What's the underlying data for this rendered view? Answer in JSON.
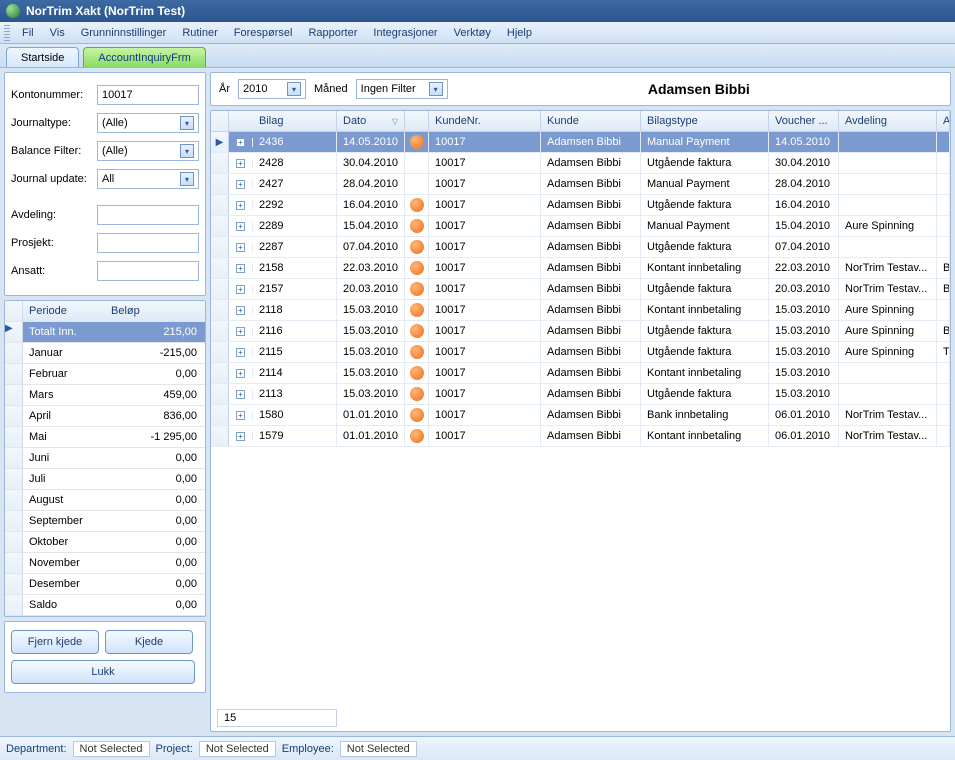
{
  "window": {
    "title": "NorTrim Xakt (NorTrim Test)"
  },
  "menu": [
    "Fil",
    "Vis",
    "Grunninnstillinger",
    "Rutiner",
    "Forespørsel",
    "Rapporter",
    "Integrasjoner",
    "Verktøy",
    "Hjelp"
  ],
  "tabs": {
    "start": "Startside",
    "inquiry": "AccountInquiryFrm"
  },
  "filters": {
    "kontonummer_label": "Kontonummer:",
    "kontonummer": "10017",
    "journaltype_label": "Journaltype:",
    "journaltype": "(Alle)",
    "balance_label": "Balance Filter:",
    "balance": "(Alle)",
    "update_label": "Journal update:",
    "update": "All",
    "avdeling_label": "Avdeling:",
    "avdeling": "",
    "prosjekt_label": "Prosjekt:",
    "prosjekt": "",
    "ansatt_label": "Ansatt:",
    "ansatt": ""
  },
  "periods": {
    "headers": {
      "c1": "Periode",
      "c2": "Beløp"
    },
    "rows": [
      {
        "label": "Totalt Inn.",
        "value": "215,00",
        "selected": true
      },
      {
        "label": "Januar",
        "value": "-215,00"
      },
      {
        "label": "Februar",
        "value": "0,00"
      },
      {
        "label": "Mars",
        "value": "459,00"
      },
      {
        "label": "April",
        "value": "836,00"
      },
      {
        "label": "Mai",
        "value": "-1 295,00"
      },
      {
        "label": "Juni",
        "value": "0,00"
      },
      {
        "label": "Juli",
        "value": "0,00"
      },
      {
        "label": "August",
        "value": "0,00"
      },
      {
        "label": "September",
        "value": "0,00"
      },
      {
        "label": "Oktober",
        "value": "0,00"
      },
      {
        "label": "November",
        "value": "0,00"
      },
      {
        "label": "Desember",
        "value": "0,00"
      },
      {
        "label": "Saldo",
        "value": "0,00"
      }
    ]
  },
  "buttons": {
    "fjern": "Fjern kjede",
    "kjede": "Kjede",
    "lukk": "Lukk"
  },
  "toolbar": {
    "ar_label": "År",
    "ar": "2010",
    "maned_label": "Måned",
    "maned": "Ingen Filter",
    "customer": "Adamsen Bibbi"
  },
  "grid": {
    "headers": {
      "bilag": "Bilag",
      "dato": "Dato",
      "kundenr": "KundeNr.",
      "kunde": "Kunde",
      "btype": "Bilagstype",
      "voucher": "Voucher ...",
      "avdeling": "Avdeling",
      "ans": "Ans"
    },
    "rows": [
      {
        "bilag": "2436",
        "dato": "14.05.2010",
        "ico": true,
        "kundenr": "10017",
        "kunde": "Adamsen Bibbi",
        "btype": "Manual Payment",
        "voucher": "14.05.2010",
        "avd": "",
        "ans": "",
        "selected": true
      },
      {
        "bilag": "2428",
        "dato": "30.04.2010",
        "ico": false,
        "kundenr": "10017",
        "kunde": "Adamsen Bibbi",
        "btype": "Utgående faktura",
        "voucher": "30.04.2010",
        "avd": "",
        "ans": ""
      },
      {
        "bilag": "2427",
        "dato": "28.04.2010",
        "ico": false,
        "kundenr": "10017",
        "kunde": "Adamsen Bibbi",
        "btype": "Manual Payment",
        "voucher": "28.04.2010",
        "avd": "",
        "ans": ""
      },
      {
        "bilag": "2292",
        "dato": "16.04.2010",
        "ico": true,
        "kundenr": "10017",
        "kunde": "Adamsen Bibbi",
        "btype": "Utgående faktura",
        "voucher": "16.04.2010",
        "avd": "",
        "ans": ""
      },
      {
        "bilag": "2289",
        "dato": "15.04.2010",
        "ico": true,
        "kundenr": "10017",
        "kunde": "Adamsen Bibbi",
        "btype": "Manual Payment",
        "voucher": "15.04.2010",
        "avd": "Aure Spinning",
        "ans": ""
      },
      {
        "bilag": "2287",
        "dato": "07.04.2010",
        "ico": true,
        "kundenr": "10017",
        "kunde": "Adamsen Bibbi",
        "btype": "Utgående faktura",
        "voucher": "07.04.2010",
        "avd": "",
        "ans": ""
      },
      {
        "bilag": "2158",
        "dato": "22.03.2010",
        "ico": true,
        "kundenr": "10017",
        "kunde": "Adamsen Bibbi",
        "btype": "Kontant innbetaling",
        "voucher": "22.03.2010",
        "avd": "NorTrim Testav...",
        "ans": "Bjør"
      },
      {
        "bilag": "2157",
        "dato": "20.03.2010",
        "ico": true,
        "kundenr": "10017",
        "kunde": "Adamsen Bibbi",
        "btype": "Utgående faktura",
        "voucher": "20.03.2010",
        "avd": "NorTrim Testav...",
        "ans": "Bjør"
      },
      {
        "bilag": "2118",
        "dato": "15.03.2010",
        "ico": true,
        "kundenr": "10017",
        "kunde": "Adamsen Bibbi",
        "btype": "Kontant innbetaling",
        "voucher": "15.03.2010",
        "avd": "Aure Spinning",
        "ans": ""
      },
      {
        "bilag": "2116",
        "dato": "15.03.2010",
        "ico": true,
        "kundenr": "10017",
        "kunde": "Adamsen Bibbi",
        "btype": "Utgående faktura",
        "voucher": "15.03.2010",
        "avd": "Aure Spinning",
        "ans": "Bjør"
      },
      {
        "bilag": "2115",
        "dato": "15.03.2010",
        "ico": true,
        "kundenr": "10017",
        "kunde": "Adamsen Bibbi",
        "btype": "Utgående faktura",
        "voucher": "15.03.2010",
        "avd": "Aure Spinning",
        "ans": "Trun"
      },
      {
        "bilag": "2114",
        "dato": "15.03.2010",
        "ico": true,
        "kundenr": "10017",
        "kunde": "Adamsen Bibbi",
        "btype": "Kontant innbetaling",
        "voucher": "15.03.2010",
        "avd": "",
        "ans": ""
      },
      {
        "bilag": "2113",
        "dato": "15.03.2010",
        "ico": true,
        "kundenr": "10017",
        "kunde": "Adamsen Bibbi",
        "btype": "Utgående faktura",
        "voucher": "15.03.2010",
        "avd": "",
        "ans": ""
      },
      {
        "bilag": "1580",
        "dato": "01.01.2010",
        "ico": true,
        "kundenr": "10017",
        "kunde": "Adamsen Bibbi",
        "btype": "Bank innbetaling",
        "voucher": "06.01.2010",
        "avd": "NorTrim Testav...",
        "ans": ""
      },
      {
        "bilag": "1579",
        "dato": "01.01.2010",
        "ico": true,
        "kundenr": "10017",
        "kunde": "Adamsen Bibbi",
        "btype": "Kontant innbetaling",
        "voucher": "06.01.2010",
        "avd": "NorTrim Testav...",
        "ans": ""
      }
    ],
    "count": "15"
  },
  "status": {
    "dept_label": "Department:",
    "dept": "Not Selected",
    "proj_label": "Project:",
    "proj": "Not Selected",
    "emp_label": "Employee:",
    "emp": "Not Selected"
  }
}
